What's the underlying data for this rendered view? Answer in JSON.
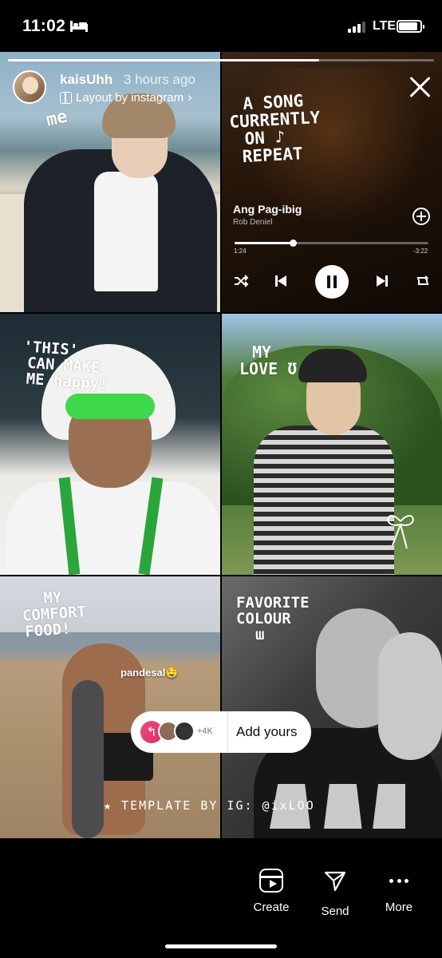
{
  "status_bar": {
    "time": "11:02",
    "network": "LTE",
    "battery_level": 0.9,
    "icons": [
      "bed-icon",
      "signal-icon",
      "battery-icon"
    ]
  },
  "story": {
    "progress": 0.73,
    "username": "kaisUhh",
    "timestamp": "3 hours ago",
    "layout_credit": "Layout by instagram",
    "layout_chevron": "›",
    "close_icon": "close-icon",
    "cells": [
      {
        "doodle": "me",
        "lines": [
          "me"
        ]
      },
      {
        "doodle": "a song currently on repeat",
        "lines": [
          "A SONG",
          "CURRENTLY",
          "ON ♪",
          "REPEAT"
        ]
      },
      {
        "doodle": "this can make me happy!",
        "lines": [
          "'THIS'",
          "CAN MAKE",
          "ME happy!"
        ]
      },
      {
        "doodle": "my love",
        "lines": [
          "MY",
          "LOVE ʊ"
        ]
      },
      {
        "doodle": "my comfort food",
        "lines": [
          "MY",
          "COMFORT",
          "FOOD!"
        ]
      },
      {
        "doodle": "favorite colour",
        "lines": [
          "FAVORITE",
          "COLOUR",
          "ɯ"
        ]
      }
    ],
    "music": {
      "title": "Ang Pag-ibig",
      "artist": "Rob Deniel",
      "elapsed": "1:24",
      "remaining": "-3:22",
      "progress": 0.3,
      "controls": [
        "shuffle-icon",
        "previous-icon",
        "pause-icon",
        "next-icon",
        "repeat-icon"
      ]
    },
    "sticker_text": "pandesal🤤",
    "add_yours": {
      "count": "+4K",
      "label": "Add yours"
    },
    "template_credit": "★ TEMPLATE BY IG: @ixLOO"
  },
  "bottom_actions": [
    {
      "label": "Create",
      "icon": "create-icon"
    },
    {
      "label": "Send",
      "icon": "send-icon"
    },
    {
      "label": "More",
      "icon": "more-icon"
    }
  ]
}
